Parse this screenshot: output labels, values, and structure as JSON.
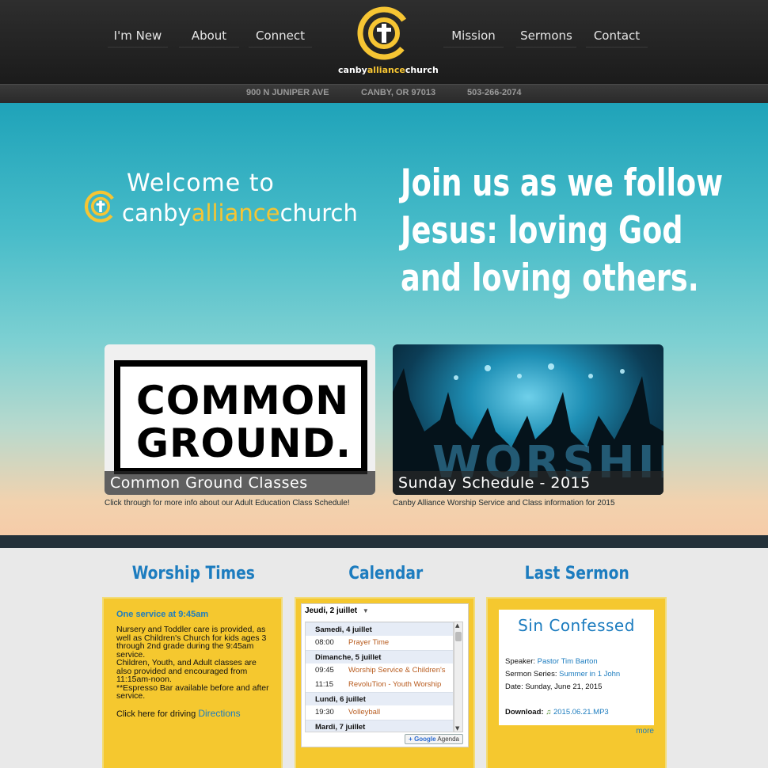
{
  "nav": {
    "left": [
      "I'm New",
      "About",
      "Connect"
    ],
    "right": [
      "Mission",
      "Sermons",
      "Contact"
    ]
  },
  "logo": {
    "part1": "canby",
    "part2": "alliance",
    "part3": "church"
  },
  "info": {
    "address": "900 N JUNIPER AVE",
    "city": "CANBY, OR 97013",
    "phone": "503-266-2074"
  },
  "hero": {
    "welcome_to": "Welcome to",
    "name_part1": "canby",
    "name_part2": "alliance",
    "name_part3": "church",
    "tagline": "Join us as we follow Jesus: loving God and loving others."
  },
  "cards": [
    {
      "caption": "Common Ground Classes",
      "desc": "Click through for more info about our Adult Education Class Schedule!",
      "line1": "COMMON",
      "line2": "GROUND."
    },
    {
      "caption": "Sunday Schedule - 2015",
      "desc": "Canby Alliance Worship Service and Class information for 2015",
      "word": "WORSHIP"
    }
  ],
  "worship_times": {
    "title": "Worship Times",
    "head": "One service at 9:45am",
    "body": [
      "Nursery and Toddler care is provided, as well as Children's Church for kids ages 3 through 2nd grade during the 9:45am service.",
      "Children, Youth, and Adult classes are also provided and encouraged from 11:15am-noon.",
      "**Espresso Bar available before and after service."
    ],
    "directions_prefix": "Click here for driving",
    "directions_link": "Directions"
  },
  "calendar": {
    "title": "Calendar",
    "current": "Jeudi, 2 juillet",
    "days": [
      {
        "day": "Samedi, 4 juillet",
        "events": [
          {
            "time": "08:00",
            "name": "Prayer Time"
          }
        ]
      },
      {
        "day": "Dimanche, 5 juillet",
        "events": [
          {
            "time": "09:45",
            "name": "Worship Service & Children's"
          },
          {
            "time": "11:15",
            "name": "RevoluTion - Youth Worship"
          }
        ]
      },
      {
        "day": "Lundi, 6 juillet",
        "events": [
          {
            "time": "19:30",
            "name": "Volleyball"
          }
        ]
      },
      {
        "day": "Mardi, 7 juillet",
        "events": []
      }
    ],
    "badge_brand": "Google",
    "badge_label": "Agenda"
  },
  "last_sermon": {
    "title": "Last Sermon",
    "sermon_title": "Sin Confessed",
    "speaker_label": "Speaker:",
    "speaker": "Pastor Tim Barton",
    "series_label": "Sermon Series:",
    "series": "Summer in 1 John",
    "date": "Date: Sunday, June 21, 2015",
    "download_label": "Download:",
    "file": "2015.06.21.MP3",
    "more": "more"
  },
  "colors": {
    "accent_blue": "#1c7cbf",
    "brand_yellow": "#f6c533",
    "panel_yellow": "#f5c82f",
    "header_dark": "#222222"
  }
}
